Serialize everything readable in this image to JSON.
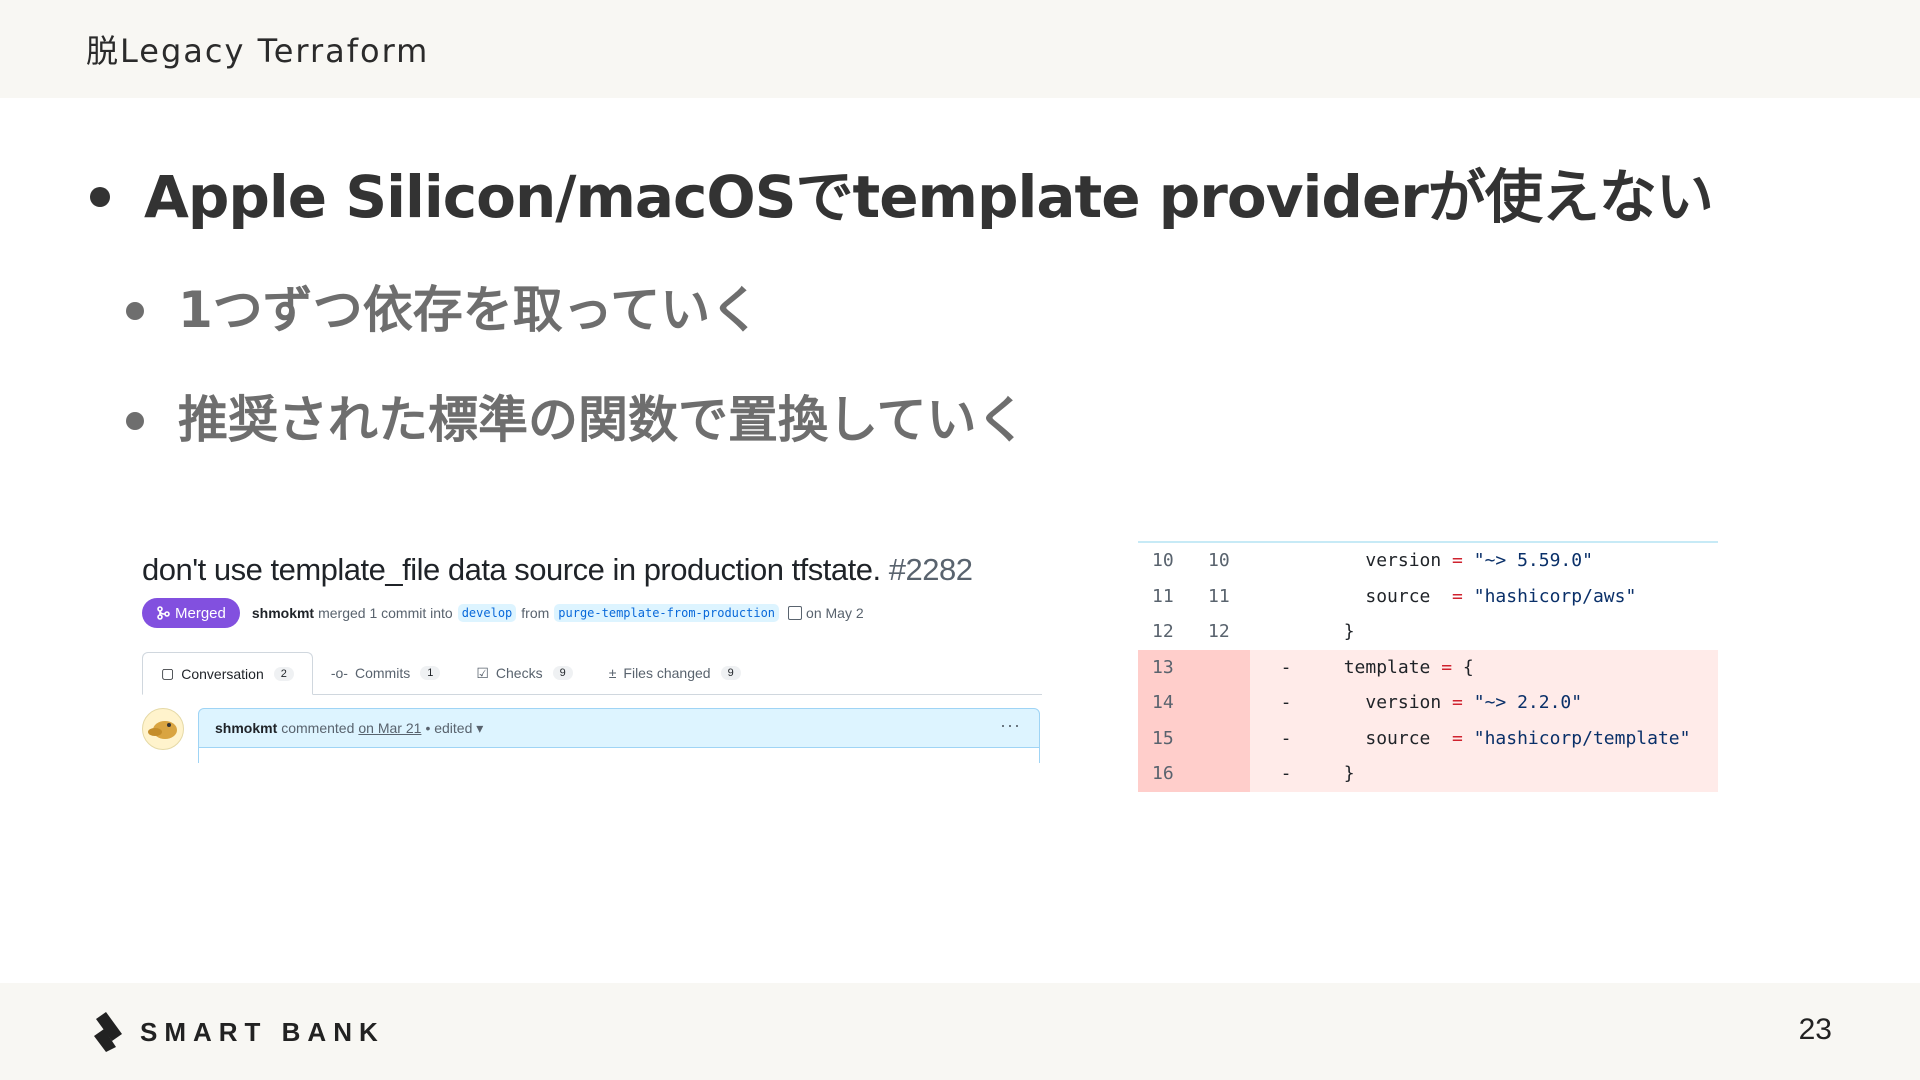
{
  "header": {
    "title": "脱Legacy Terraform"
  },
  "bullets": {
    "main": "Apple Silicon/macOSでtemplate providerが使えない",
    "sub": [
      "1つずつ依存を取っていく",
      "推奨された標準の関数で置換していく"
    ]
  },
  "pull_request": {
    "title": "don't use template_file data source in production tfstate.",
    "number": "#2282",
    "status": "Merged",
    "author": "shmokmt",
    "merged_text": "merged 1 commit into",
    "base_branch": "develop",
    "from_text": "from",
    "head_branch": "purge-template-from-production",
    "date_text": "on May 2",
    "tabs": [
      {
        "label": "Conversation",
        "count": "2",
        "icon": "conversation-icon"
      },
      {
        "label": "Commits",
        "count": "1",
        "icon": "commit-icon"
      },
      {
        "label": "Checks",
        "count": "9",
        "icon": "checks-icon"
      },
      {
        "label": "Files changed",
        "count": "9",
        "icon": "file-diff-icon"
      }
    ],
    "comment": {
      "user": "shmokmt",
      "action": "commented",
      "date": "on Mar 21",
      "edited": "• edited",
      "menu": "···"
    },
    "colors": {
      "merged": "#8250df",
      "link": "#0969da",
      "comment_header": "#ddf4ff"
    }
  },
  "diff": {
    "rows": [
      {
        "old": "10",
        "new": "10",
        "sign": "",
        "type": "context",
        "indent": "    ",
        "key": "version",
        "op": " = ",
        "value": "\"~> 5.59.0\""
      },
      {
        "old": "11",
        "new": "11",
        "sign": "",
        "type": "context",
        "indent": "    ",
        "key": "source ",
        "op": " = ",
        "value": "\"hashicorp/aws\""
      },
      {
        "old": "12",
        "new": "12",
        "sign": "",
        "type": "context",
        "indent": "  ",
        "key": "}",
        "op": "",
        "value": ""
      },
      {
        "old": "13",
        "new": "",
        "sign": "-",
        "type": "del",
        "indent": "  ",
        "key": "template",
        "op": " = ",
        "value": "{"
      },
      {
        "old": "14",
        "new": "",
        "sign": "-",
        "type": "del",
        "indent": "    ",
        "key": "version",
        "op": " = ",
        "value": "\"~> 2.2.0\""
      },
      {
        "old": "15",
        "new": "",
        "sign": "-",
        "type": "del",
        "indent": "    ",
        "key": "source ",
        "op": " = ",
        "value": "\"hashicorp/template\""
      },
      {
        "old": "16",
        "new": "",
        "sign": "-",
        "type": "del",
        "indent": "  ",
        "key": "}",
        "op": "",
        "value": ""
      }
    ],
    "colors": {
      "deleted_bg": "#ffebe9",
      "deleted_number_bg": "#ffcecb"
    }
  },
  "footer": {
    "logo": "SMART BANK",
    "page_number": "23"
  }
}
